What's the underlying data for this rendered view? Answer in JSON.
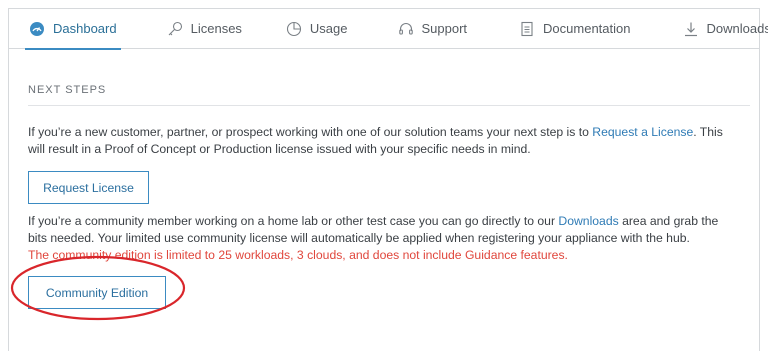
{
  "nav": {
    "items": [
      {
        "label": "Dashboard",
        "icon": "dashboard-gauge-icon"
      },
      {
        "label": "Licenses",
        "icon": "key-icon"
      },
      {
        "label": "Usage",
        "icon": "pie-chart-icon"
      },
      {
        "label": "Support",
        "icon": "headset-icon"
      },
      {
        "label": "Documentation",
        "icon": "document-icon"
      },
      {
        "label": "Downloads",
        "icon": "download-icon"
      }
    ],
    "active_color": "#3b8bc2"
  },
  "main": {
    "section_title": "NEXT STEPS",
    "p1": {
      "before": "If you’re a new customer, partner, or prospect working with one of our solution teams your next step is to ",
      "link": "Request a License",
      "after": ". This will result in a Proof of Concept or Production license issued with your specific needs in mind."
    },
    "request_button": "Request License",
    "p2": {
      "before": "If you’re a community member working on a home lab or other test case you can go directly to our ",
      "link": "Downloads",
      "after": " area and grab the bits needed. Your limited use community license will automatically be applied when registering your appliance with the hub."
    },
    "warning": "The community edition is limited to 25 workloads, 3 clouds, and does not include Guidance features.",
    "community_button": "Community Edition"
  },
  "colors": {
    "link": "#2f7bb5",
    "warning": "#e0463c",
    "annotation": "#d9262b"
  }
}
